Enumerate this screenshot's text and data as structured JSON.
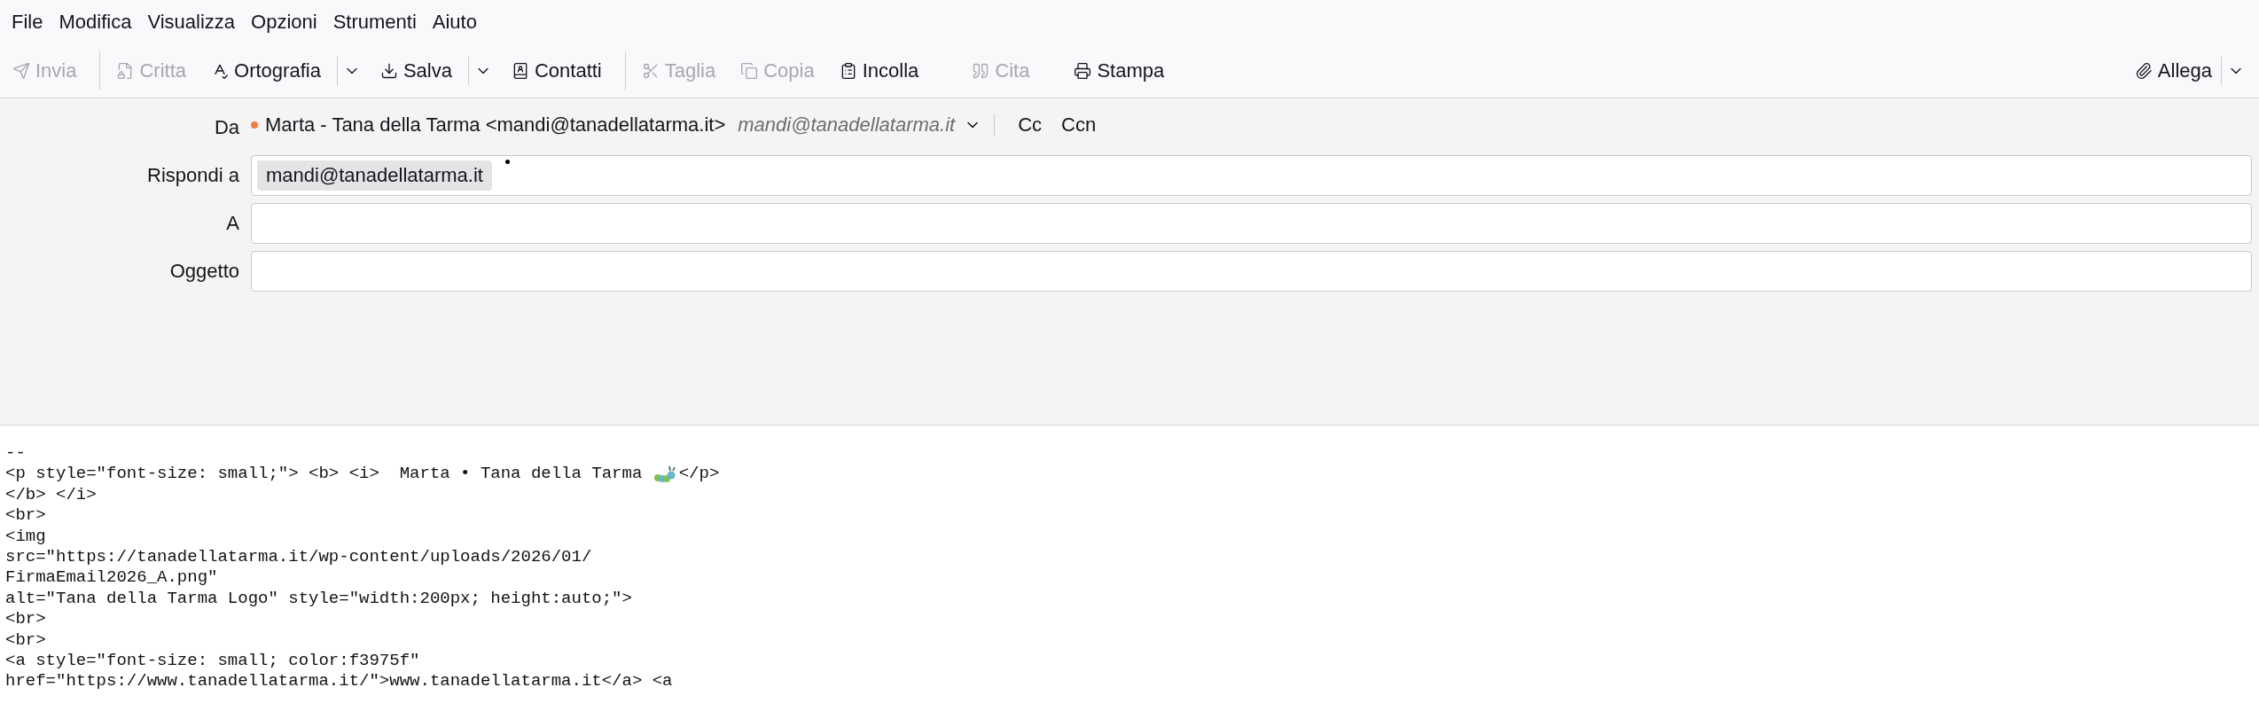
{
  "menu": [
    "File",
    "Modifica",
    "Visualizza",
    "Opzioni",
    "Strumenti",
    "Aiuto"
  ],
  "toolbar": [
    {
      "kind": "button",
      "label": "Invia",
      "disabled": true
    },
    {
      "kind": "separator"
    },
    {
      "kind": "button",
      "label": "Critta",
      "disabled": true
    },
    {
      "kind": "button",
      "label": "Ortografia",
      "disabled": false
    },
    {
      "kind": "dropdown"
    },
    {
      "kind": "button",
      "label": "Salva",
      "disabled": false
    },
    {
      "kind": "dropdown"
    },
    {
      "kind": "button",
      "label": "Contatti",
      "disabled": false
    },
    {
      "kind": "separator"
    },
    {
      "kind": "button",
      "label": "Taglia",
      "disabled": true
    },
    {
      "kind": "button",
      "label": "Copia",
      "disabled": true
    },
    {
      "kind": "button",
      "label": "Incolla",
      "disabled": false
    },
    {
      "kind": "button",
      "label": "Cita",
      "disabled": true
    },
    {
      "kind": "button",
      "label": "Stampa",
      "disabled": false
    }
  ],
  "attach": {
    "label": "Allega"
  },
  "header": {
    "from_label": "Da",
    "identity": "Marta - Tana della Tarma <mandi@tanadellatarma.it>",
    "identity_email": "mandi@tanadellatarma.it",
    "cc": "Cc",
    "bcc": "Ccn",
    "fields": [
      {
        "label": "Rispondi a",
        "pills": [
          "mandi@tanadellatarma.it"
        ]
      },
      {
        "label": "A"
      },
      {
        "label": "Oggetto"
      }
    ]
  },
  "body": {
    "lines": [
      {
        "text": "--"
      },
      {
        "text": "<p style=\"font-size: small;\"> <b> <i>  Marta • Tana della Tarma ",
        "after": "</p>"
      },
      {
        "text": "</b> </i>"
      },
      {
        "text": "<br>"
      },
      {
        "text": "<img"
      },
      {
        "text": "src=\"https://tanadellatarma.it/wp-content/uploads/2026/01/"
      },
      {
        "text": "FirmaEmail2026_A.png\""
      },
      {
        "text": "alt=\"Tana della Tarma Logo\" style=\"width:200px; height:auto;\">"
      },
      {
        "text": "<br>"
      },
      {
        "text": "<br>"
      },
      {
        "text": "<a style=\"font-size: small; color:f3975f\""
      },
      {
        "text": "href=\"https://www.tanadellatarma.it/\">www.tanadellatarma.it</a> <a"
      }
    ]
  }
}
